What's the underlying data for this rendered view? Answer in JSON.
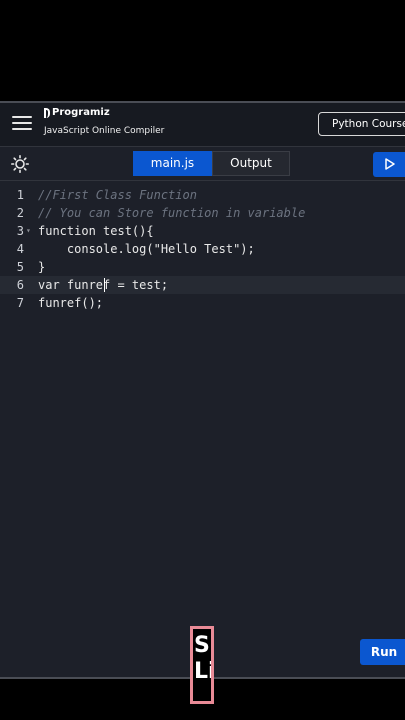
{
  "header": {
    "brand": "Programiz",
    "subtitle": "JavaScript Online Compiler",
    "course_button": "Python Course"
  },
  "toolbar": {
    "tabs": [
      {
        "label": "main.js",
        "active": true
      },
      {
        "label": "Output",
        "active": false
      }
    ]
  },
  "editor": {
    "active_line": 6,
    "lines": [
      {
        "num": "1",
        "text": "//First Class Function"
      },
      {
        "num": "2",
        "text": "// You can Store function in variable"
      },
      {
        "num": "3",
        "text": "function test(){"
      },
      {
        "num": "4",
        "text": "    console.log(\"Hello Test\");"
      },
      {
        "num": "5",
        "text": "}"
      },
      {
        "num": "6",
        "text": "var funref = test;"
      },
      {
        "num": "7",
        "text": "funref();"
      }
    ]
  },
  "run_button": "Run",
  "caption": {
    "line1": "Su",
    "line2": "Li"
  },
  "colors": {
    "accent": "#0b57d0",
    "background": "#1d2029",
    "caption_border": "#e88a96"
  }
}
